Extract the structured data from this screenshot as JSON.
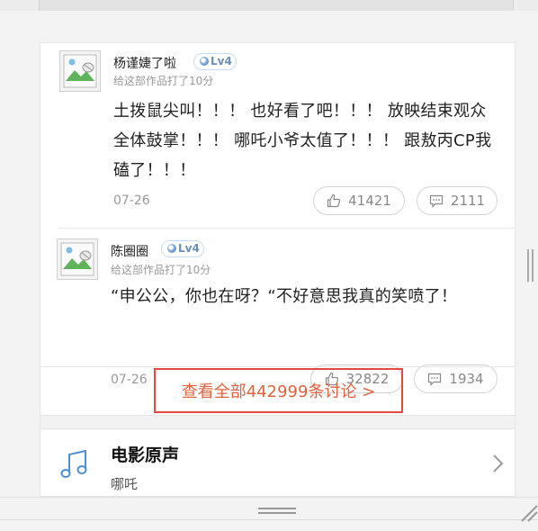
{
  "comments": [
    {
      "username": "杨谨婕了啦",
      "level": "Lv4",
      "score_text": "给这部作品打了10分",
      "lines": [
        "土拨鼠尖叫！！！ 也好看了吧！！！ 放映结束观众",
        "全体鼓掌！！！ 哪吒小爷太值了！！！ 跟敖丙CP我",
        "磕了！！！"
      ],
      "date": "07-26",
      "likes": "41421",
      "replies": "2111"
    },
    {
      "username": "陈圈圈",
      "level": "Lv4",
      "score_text": "给这部作品打了10分",
      "lines": [
        "“申公公，你也在呀？“不好意思我真的笑喷了！"
      ],
      "date": "07-26",
      "likes": "32822",
      "replies": "1934"
    }
  ],
  "view_all": "查看全部442999条讨论 >",
  "soundtrack": {
    "title": "电影原声",
    "subtitle": "哪吒",
    "icon": "music-note-icon"
  },
  "colors": {
    "accent_red": "#e24a3f",
    "link_orange": "#e0613d",
    "level_blue": "#6b8eb4",
    "music_blue": "#4a90d9"
  }
}
